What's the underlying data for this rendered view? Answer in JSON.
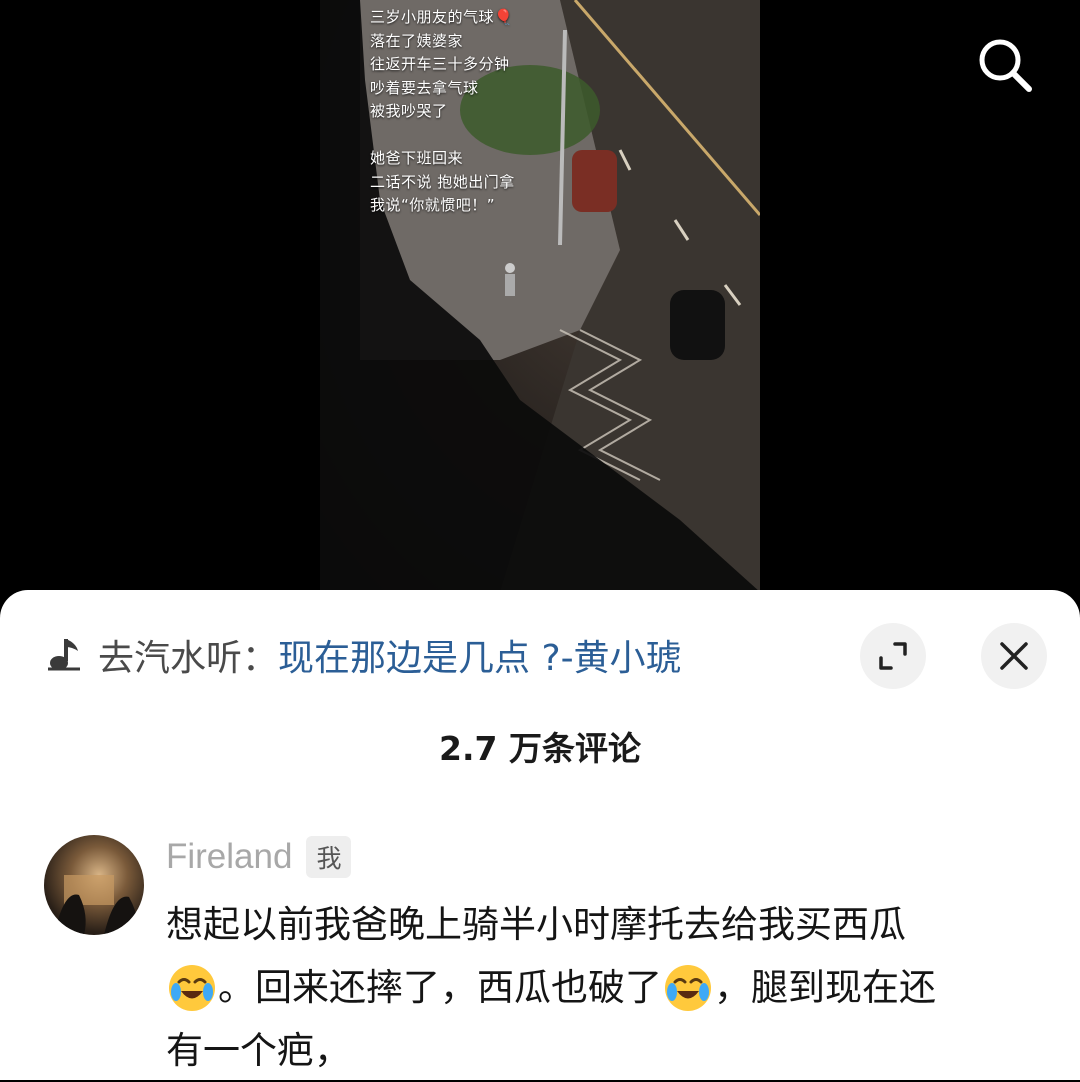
{
  "video": {
    "caption_lines": [
      "三岁小朋友的气球🎈",
      "落在了姨婆家",
      "往返开车三十多分钟",
      "吵着要去拿气球",
      "被我吵哭了",
      "",
      "她爸下班回来",
      "二话不说 抱她出门拿",
      "我说“你就惯吧！”"
    ]
  },
  "toolbar": {
    "search_icon": "search-icon"
  },
  "music": {
    "icon": "music-note-icon",
    "prefix": "去汽水听：",
    "title": "现在那边是几点 ?-黄小琥"
  },
  "sheet": {
    "expand_icon": "expand-icon",
    "close_icon": "close-icon",
    "comment_count": "2.7 万条评论"
  },
  "comment": {
    "username": "Fireland",
    "badge": "我",
    "line1": "想起以前我爸晚上骑半小时摩托去给我买西瓜",
    "line2_a": "。回来还摔了，西瓜也破了",
    "line2_b": "，腿到现在还",
    "line3": "有一个疤，",
    "emoji": "crying-laughing-emoji"
  },
  "colors": {
    "link": "#2b5e96",
    "username": "#a8a8a8",
    "sheet_bg": "#ffffff",
    "page_bg": "#000000"
  }
}
